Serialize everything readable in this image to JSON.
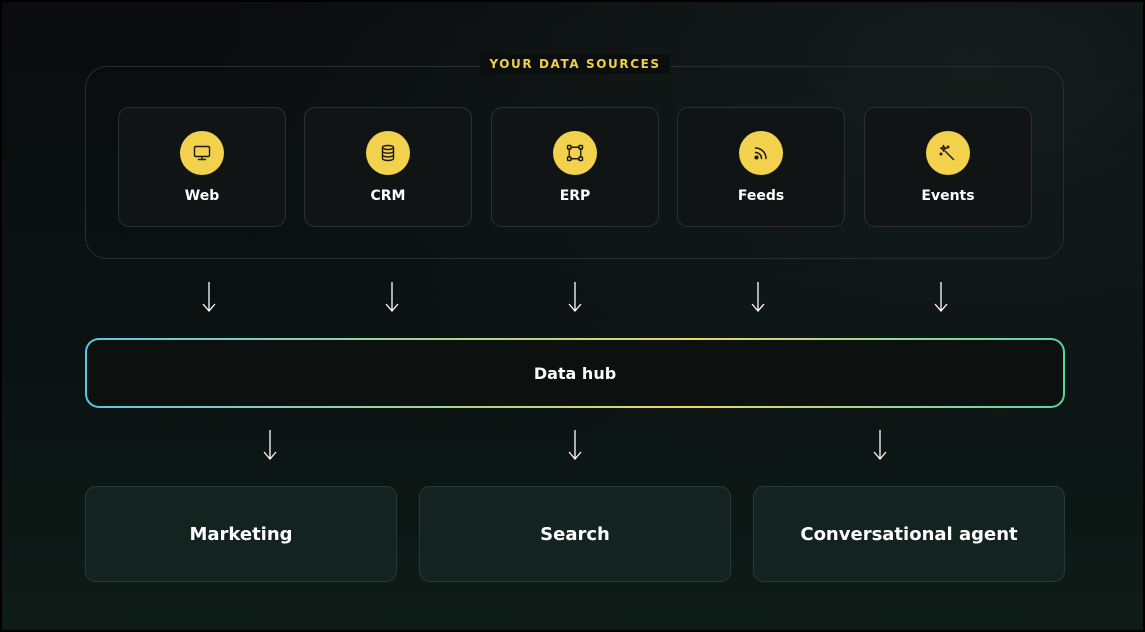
{
  "sources": {
    "title": "YOUR DATA SOURCES",
    "items": [
      {
        "label": "Web",
        "icon": "monitor-icon"
      },
      {
        "label": "CRM",
        "icon": "database-icon"
      },
      {
        "label": "ERP",
        "icon": "nodes-icon"
      },
      {
        "label": "Feeds",
        "icon": "rss-icon"
      },
      {
        "label": "Events",
        "icon": "wand-icon"
      }
    ]
  },
  "hub": {
    "label": "Data hub"
  },
  "destinations": {
    "items": [
      {
        "label": "Marketing"
      },
      {
        "label": "Search"
      },
      {
        "label": "Conversational agent"
      }
    ]
  },
  "colors": {
    "accent": "#f2d24c",
    "hub_gradient": [
      "#5bc6e6",
      "#e9d661",
      "#59d3a1"
    ]
  }
}
